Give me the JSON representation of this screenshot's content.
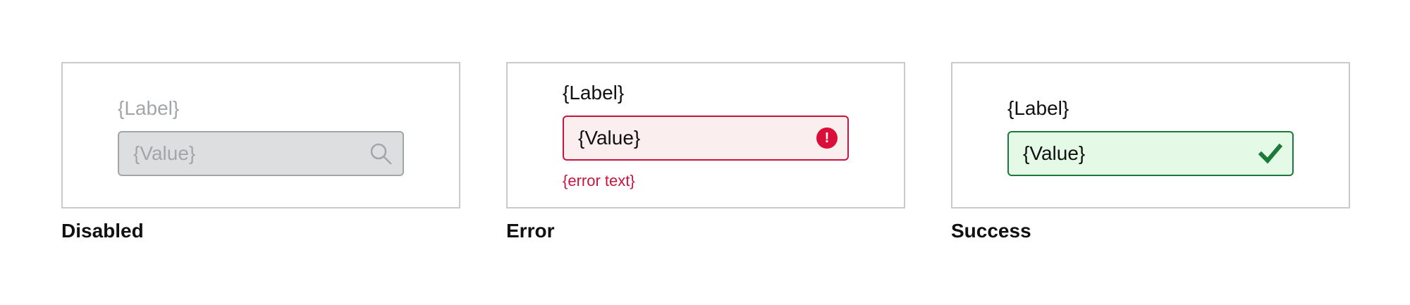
{
  "states": {
    "disabled": {
      "caption": "Disabled",
      "label": "{Label}",
      "value": "{Value}",
      "icon": "search-icon"
    },
    "error": {
      "caption": "Error",
      "label": "{Label}",
      "value": "{Value}",
      "icon": "error-icon",
      "icon_glyph": "!",
      "error_text": "{error text}"
    },
    "success": {
      "caption": "Success",
      "label": "{Label}",
      "value": "{Value}",
      "icon": "checkmark-icon"
    }
  },
  "colors": {
    "panel_border": "#c8cacc",
    "disabled_text": "#a3a6a9",
    "disabled_fill": "#dcdee0",
    "error_border": "#c8153e",
    "error_fill": "#fbeeee",
    "error_icon": "#d90f3a",
    "success_border": "#1b7a3a",
    "success_fill": "#e4fae6",
    "success_icon": "#1b7a3a"
  }
}
